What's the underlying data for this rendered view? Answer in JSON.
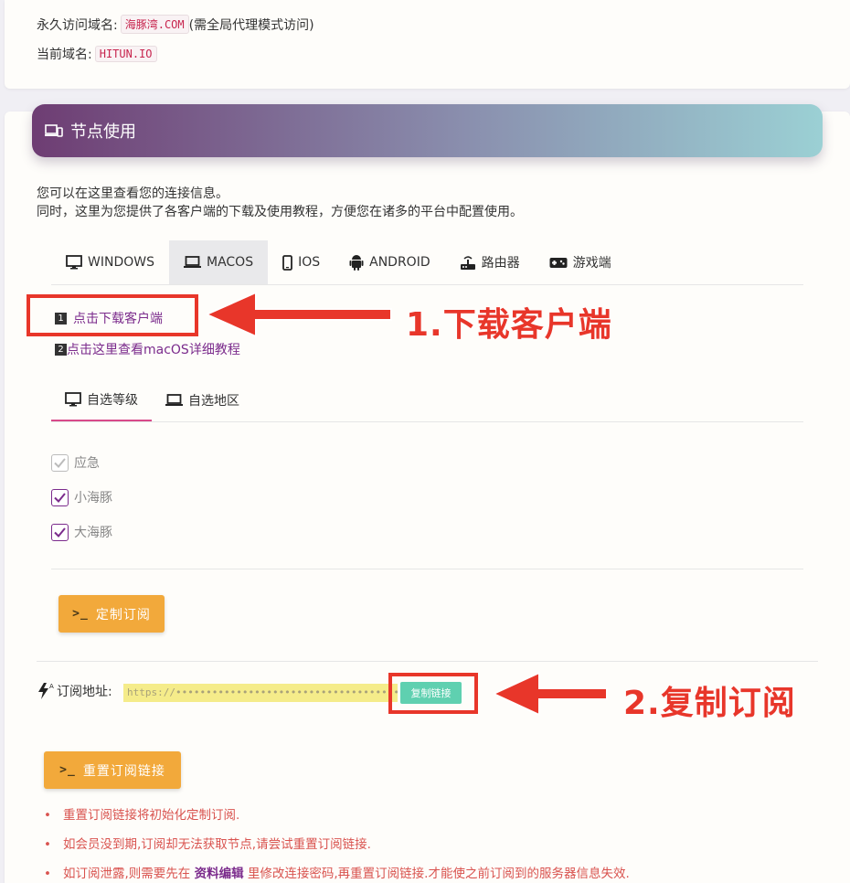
{
  "domains": {
    "permanent_label": "永久访问域名:",
    "permanent_value": "海豚湾.COM",
    "permanent_note": "(需全局代理模式访问)",
    "current_label": "当前域名:",
    "current_value": "HITUN.IO"
  },
  "section": {
    "title": "节点使用",
    "icon": "devices-icon",
    "intro_line1": "您可以在这里查看您的连接信息。",
    "intro_line2": "同时，这里为您提供了各客户端的下载及使用教程，方便您在诸多的平台中配置使用。"
  },
  "platform_tabs": [
    {
      "label": "WINDOWS",
      "icon": "monitor-icon",
      "active": false
    },
    {
      "label": "MACOS",
      "icon": "laptop-icon",
      "active": true
    },
    {
      "label": "IOS",
      "icon": "phone-icon",
      "active": false
    },
    {
      "label": "ANDROID",
      "icon": "android-icon",
      "active": false
    },
    {
      "label": "路由器",
      "icon": "router-icon",
      "active": false
    },
    {
      "label": "游戏端",
      "icon": "gamepad-icon",
      "active": false
    }
  ],
  "links": {
    "download_num": "1",
    "download": "点击下载客户端",
    "tutorial_num": "2",
    "tutorial": "点击这里查看macOS详细教程"
  },
  "annotations": {
    "step1": "1.下载客户端",
    "step2": "2.复制订阅"
  },
  "filter_tabs": [
    {
      "label": "自选等级",
      "icon": "monitor-icon",
      "active": true
    },
    {
      "label": "自选地区",
      "icon": "laptop-icon",
      "active": false
    }
  ],
  "levels": [
    {
      "label": "应急",
      "checked": true,
      "disabled": true
    },
    {
      "label": "小海豚",
      "checked": true,
      "disabled": false
    },
    {
      "label": "大海豚",
      "checked": true,
      "disabled": false
    }
  ],
  "buttons": {
    "prompt": ">_",
    "customize": "定制订阅",
    "reset": "重置订阅链接",
    "copy": "复制链接"
  },
  "subscription": {
    "label": "订阅地址:",
    "icon": "bolt-icon",
    "url": "https://••••••••••••••••••••••••••••••••••••••••"
  },
  "notes": {
    "n1": "重置订阅链接将初始化定制订阅.",
    "n2": "如会员没到期,订阅却无法获取节点,请尝试重置订阅链接.",
    "n3_before": "如订阅泄露,则需要先在",
    "n3_link": "资料编辑",
    "n3_after": "里修改连接密码,再重置订阅链接.才能使之前订阅到的服务器信息失效."
  },
  "colors": {
    "accent_purple": "#7b2b8c",
    "annotation_red": "#e8362a",
    "button_orange": "#f2a93b",
    "copy_green": "#5fd0b0",
    "note_red": "#d9534f"
  }
}
